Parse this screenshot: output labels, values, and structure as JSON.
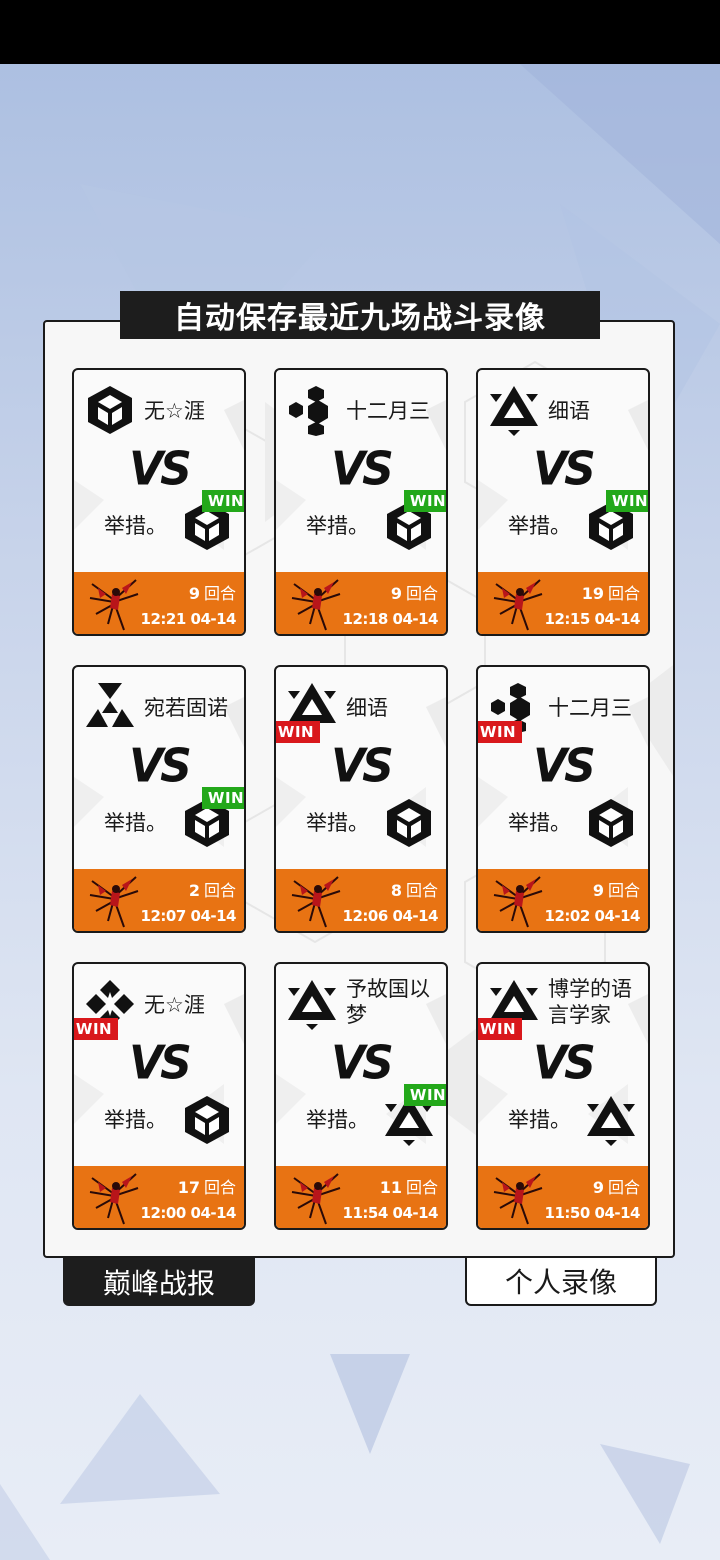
{
  "title": "自动保存最近九场战斗录像",
  "colors": {
    "footer": "#e87313",
    "win_green": "#23a81a",
    "win_red": "#d9181c",
    "dark": "#1d1d1d"
  },
  "vs_label": "VS",
  "rounds_suffix": "回合",
  "win_label": "WIN",
  "battles": [
    {
      "p1_name": "无☆涯",
      "p1_emblem": "cube-emblem-icon",
      "p2_name": "举措。",
      "p2_emblem": "cube-emblem-icon",
      "winner": "p2",
      "rounds": "9",
      "time": "12:21 04-14"
    },
    {
      "p1_name": "十二月三",
      "p1_emblem": "hex-cluster-emblem-icon",
      "p2_name": "举措。",
      "p2_emblem": "cube-emblem-icon",
      "winner": "p2",
      "rounds": "9",
      "time": "12:18 04-14"
    },
    {
      "p1_name": "细语",
      "p1_emblem": "triangle-emblem-icon",
      "p2_name": "举措。",
      "p2_emblem": "cube-emblem-icon",
      "winner": "p2",
      "rounds": "19",
      "time": "12:15 04-14"
    },
    {
      "p1_name": "宛若固诺",
      "p1_emblem": "tri-triangle-emblem-icon",
      "p2_name": "举措。",
      "p2_emblem": "cube-emblem-icon",
      "winner": "p2",
      "rounds": "2",
      "time": "12:07 04-14"
    },
    {
      "p1_name": "细语",
      "p1_emblem": "triangle-emblem-icon",
      "p2_name": "举措。",
      "p2_emblem": "cube-emblem-icon",
      "winner": "p1",
      "rounds": "8",
      "time": "12:06 04-14"
    },
    {
      "p1_name": "十二月三",
      "p1_emblem": "hex-cluster-emblem-icon",
      "p2_name": "举措。",
      "p2_emblem": "cube-emblem-icon",
      "winner": "p1",
      "rounds": "9",
      "time": "12:02 04-14"
    },
    {
      "p1_name": "无☆涯",
      "p1_emblem": "diamond-cluster-emblem-icon",
      "p2_name": "举措。",
      "p2_emblem": "cube-emblem-icon",
      "winner": "p1",
      "rounds": "17",
      "time": "12:00 04-14"
    },
    {
      "p1_name": "予故国以梦",
      "p1_emblem": "triangle-emblem-icon",
      "p2_name": "举措。",
      "p2_emblem": "triangle-emblem-icon",
      "winner": "p2",
      "rounds": "11",
      "time": "11:54 04-14"
    },
    {
      "p1_name": "博学的语言学家",
      "p1_emblem": "triangle-emblem-icon",
      "p2_name": "举措。",
      "p2_emblem": "triangle-emblem-icon",
      "winner": "p1",
      "rounds": "9",
      "time": "11:50 04-14"
    }
  ],
  "tabs": {
    "peak_report": "巅峰战报",
    "personal_replay": "个人录像"
  }
}
